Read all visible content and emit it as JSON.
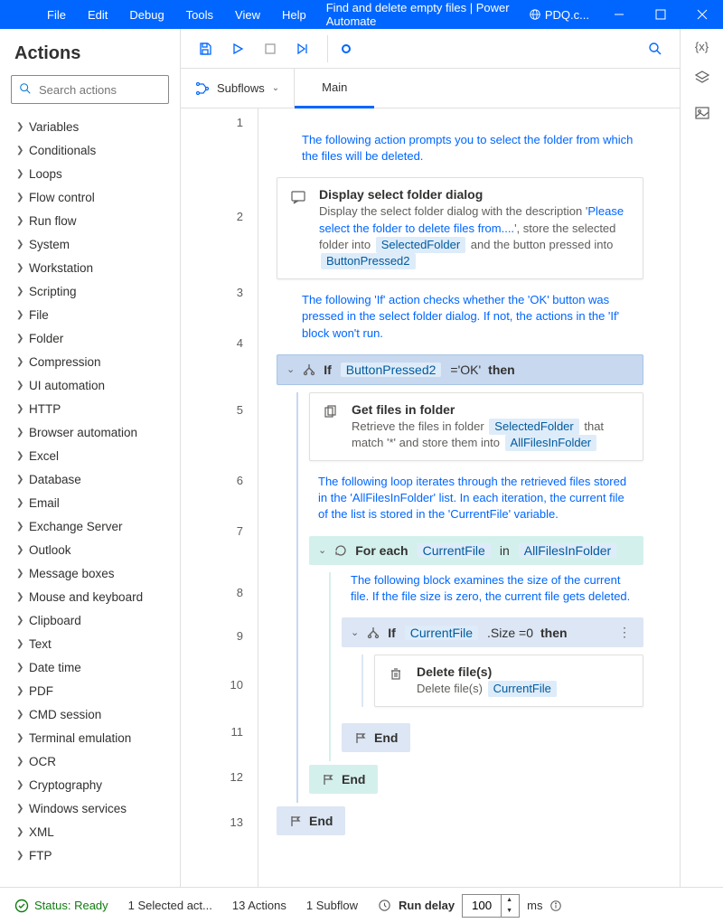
{
  "titlebar": {
    "menu": [
      "File",
      "Edit",
      "Debug",
      "Tools",
      "View",
      "Help"
    ],
    "title": "Find and delete empty files | Power Automate",
    "pdq": "PDQ.c..."
  },
  "actions": {
    "header": "Actions",
    "search_placeholder": "Search actions",
    "groups": [
      "Variables",
      "Conditionals",
      "Loops",
      "Flow control",
      "Run flow",
      "System",
      "Workstation",
      "Scripting",
      "File",
      "Folder",
      "Compression",
      "UI automation",
      "HTTP",
      "Browser automation",
      "Excel",
      "Database",
      "Email",
      "Exchange Server",
      "Outlook",
      "Message boxes",
      "Mouse and keyboard",
      "Clipboard",
      "Text",
      "Date time",
      "PDF",
      "CMD session",
      "Terminal emulation",
      "OCR",
      "Cryptography",
      "Windows services",
      "XML",
      "FTP"
    ]
  },
  "subflows": {
    "label": "Subflows",
    "tab": "Main"
  },
  "flow": {
    "comment1": "The following action prompts you to select the folder from which the files will be deleted.",
    "step2_title": "Display select folder dialog",
    "step2_desc_a": "Display the select folder dialog with the description '",
    "step2_token_a": "Please select the folder to delete files from....",
    "step2_desc_b": "', store the selected folder into ",
    "step2_token_b": "SelectedFolder",
    "step2_desc_c": " and the button pressed into ",
    "step2_token_c": "ButtonPressed2",
    "comment3": "The following 'If' action checks whether the 'OK' button was pressed in the select folder dialog. If not, the actions in the 'If' block won't run.",
    "if4_kw": "If",
    "if4_var": "ButtonPressed2",
    "if4_op": "='OK'",
    "if4_then": "then",
    "step5_title": "Get files in folder",
    "step5_desc_a": "Retrieve the files in folder ",
    "step5_token_a": "SelectedFolder",
    "step5_desc_b": " that match '*' and store them into ",
    "step5_token_b": "AllFilesInFolder",
    "comment6": "The following loop iterates through the retrieved files stored in the 'AllFilesInFolder' list. In each iteration, the current file of the list is stored in the 'CurrentFile' variable.",
    "fe7_kw": "For each",
    "fe7_var": "CurrentFile",
    "fe7_in": "in",
    "fe7_list": "AllFilesInFolder",
    "comment8": "The following block examines the size of the current file. If the file size is zero, the current file gets deleted.",
    "if9_kw": "If",
    "if9_var": "CurrentFile",
    "if9_op": ".Size =0",
    "if9_then": "then",
    "step10_title": "Delete file(s)",
    "step10_desc": "Delete file(s) ",
    "step10_token": "CurrentFile",
    "end": "End"
  },
  "status": {
    "ready": "Status: Ready",
    "selected": "1 Selected act...",
    "actions": "13 Actions",
    "subflow": "1 Subflow",
    "delay_label": "Run delay",
    "delay_value": "100",
    "ms": "ms"
  }
}
